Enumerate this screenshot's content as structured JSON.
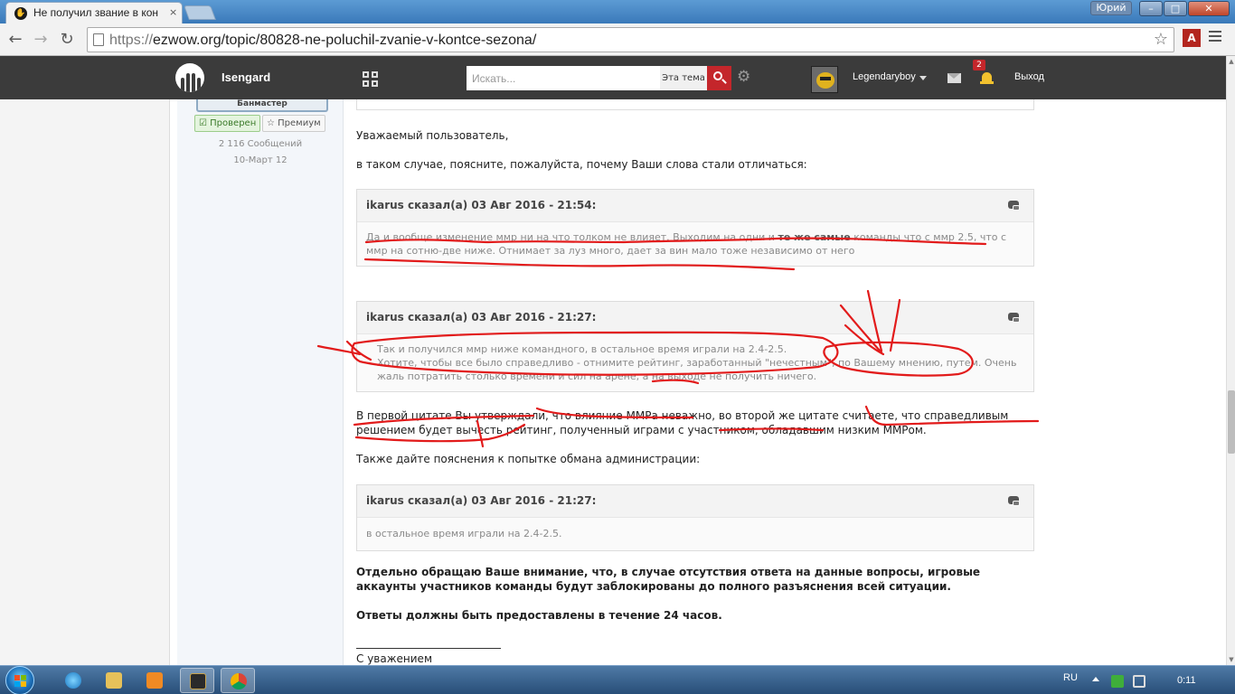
{
  "browser": {
    "tab_title": "Не получил звание в кон",
    "tab_close": "×",
    "user_chip": "Юрий",
    "url_prefix": "https://",
    "url_rest": "ezwow.org/topic/80828-ne-poluchil-zvanie-v-kontce-sezona/",
    "win_min": "–",
    "win_max": "□",
    "win_close": "✕",
    "nav_back": "←",
    "nav_forward": "→",
    "nav_reload": "↻",
    "star": "☆",
    "pdf_ext": "A"
  },
  "site": {
    "name": "Isengard",
    "search_placeholder": "Искать...",
    "search_scope": "Эта тема",
    "username": "Legendaryboy",
    "notifications_count": "2",
    "logout": "Выход",
    "gear": "⚙"
  },
  "author": {
    "group": "Банмастер",
    "verified": "Проверен",
    "premium": "Премиум",
    "posts": "2 116 Сообщений",
    "joined": "10-Март 12"
  },
  "post": {
    "greeting": "Уважаемый пользователь,",
    "ask": "в таком случае, поясните, пожалуйста, почему Ваши слова стали отличаться:",
    "quote1_cite": "ikarus сказал(а) 03 Авг 2016 - 21:54:",
    "quote1_text_a": "Да и вообще изменение ммр ни на что толком не влияет. Выходим на одни и ",
    "quote1_text_bold": "те же самые",
    "quote1_text_b": " команды что с ммр 2.5, что с ммр на сотню-две ниже. Отнимает за луз много, дает за вин мало тоже независимо от него",
    "quote2_cite": "ikarus сказал(а) 03 Авг 2016 - 21:27:",
    "quote2_line1": "Так и получился ммр ниже командного, в остальное время играли на 2.4-2.5.",
    "quote2_line2": "Хотите, чтобы все было справедливо - отнимите рейтинг, заработанный \"нечестным\", по Вашему мнению, путем. Очень жаль потратить столько времени и сил на арене, а на выходе не получить ничего.",
    "contradiction": "В первой цитате Вы утверждали, что влияние ММРа неважно, во второй же цитате считаете, что справедливым решением будет вычесть рейтинг, полученный играми с участником, обладавшим низким ММРом.",
    "admin_request": "Также дайте пояснения к попытке обмана администрации:",
    "quote3_cite": "ikarus сказал(а) 03 Авг 2016 - 21:27:",
    "quote3_text": "в остальное время играли на 2.4-2.5.",
    "warning": "Отдельно обращаю Ваше внимание, что, в случае отсутствия ответа на данные вопросы, игровые аккаунты участников команды будут заблокированы до полного разъяснения всей ситуации.",
    "deadline": "Ответы должны быть предоставлены в течение 24 часов.",
    "signoff": "С уважением"
  },
  "taskbar": {
    "lang": "RU",
    "clock": "0:11"
  },
  "colors": {
    "accent_red": "#c4262b",
    "header_bg": "#3b3b3b",
    "annotation_red": "#e21b1b"
  }
}
